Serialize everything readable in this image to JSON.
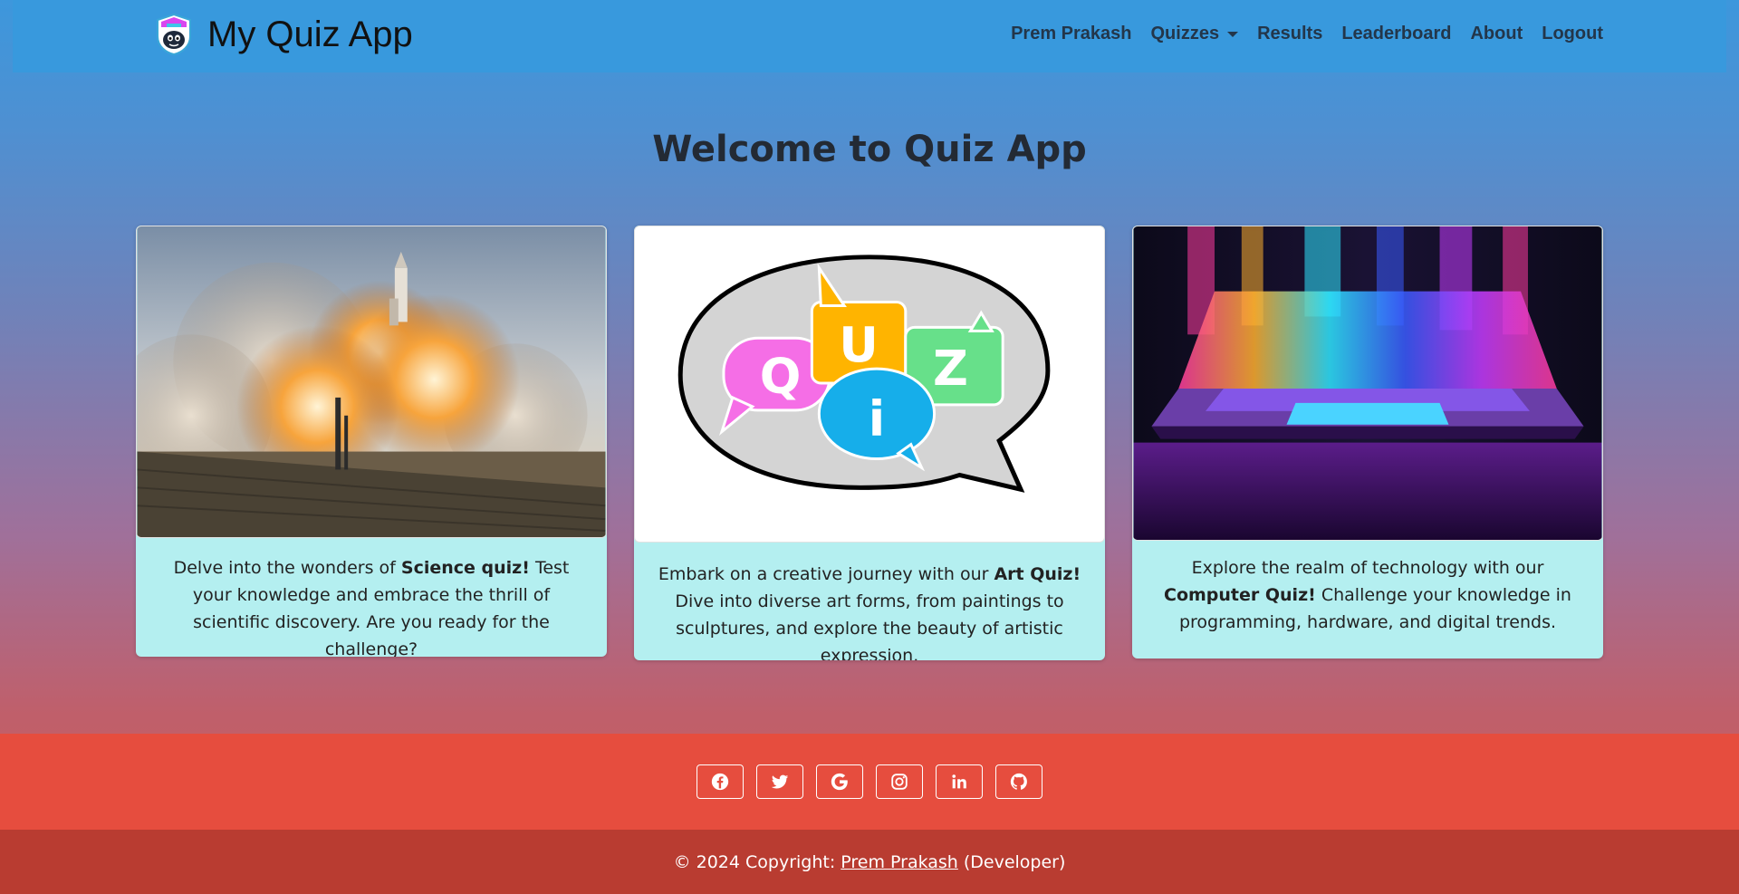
{
  "navbar": {
    "brand": "My Quiz App",
    "brand_logo_icon": "quiz-mascot-logo-icon",
    "links": [
      "Prem Prakash",
      "Quizzes",
      "Results",
      "Leaderboard",
      "About",
      "Logout"
    ]
  },
  "main": {
    "heading": "Welcome to Quiz App",
    "cards": [
      {
        "image": "rocket-launch-image",
        "text_before": "Delve into the wonders of ",
        "bold": "Science quiz!",
        "text_after": " Test your knowledge and embrace the thrill of scientific discovery. Are you ready for the challenge?"
      },
      {
        "image": "quiz-speech-bubble-image",
        "text_before": "Embark on a creative journey with our ",
        "bold": "Art Quiz!",
        "text_after": " Dive into diverse art forms, from paintings to sculptures, and explore the beauty of artistic expression."
      },
      {
        "image": "colorful-laptop-image",
        "text_before": "Explore the realm of technology with our ",
        "bold": "Computer Quiz!",
        "text_after": " Challenge your knowledge in programming, hardware, and digital trends."
      }
    ],
    "quiz_image_letters": [
      "Q",
      "U",
      "i",
      "Z"
    ]
  },
  "footer": {
    "social_icons": [
      "facebook-icon",
      "twitter-icon",
      "google-icon",
      "instagram-icon",
      "linkedin-icon",
      "github-icon"
    ],
    "copyright_prefix": "© 2024 Copyright:",
    "copyright_name": "Prem Prakash",
    "copyright_suffix": "(Developer)"
  },
  "colors": {
    "navbar": "#3899dd",
    "card_body": "#b4eff0",
    "footer_social": "#e64d3e",
    "footer_bottom": "#b93c31"
  }
}
